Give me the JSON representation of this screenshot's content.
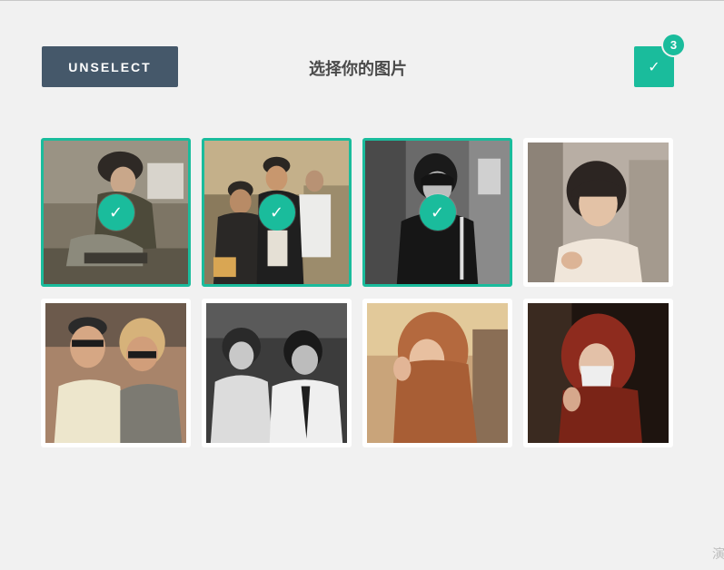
{
  "toolbar": {
    "unselect_label": "UNSELECT",
    "title": "选择你的图片",
    "confirm_icon": "check-icon",
    "selected_count": "3",
    "accent_color": "#1abc9c",
    "button_color": "#45586a"
  },
  "gallery": {
    "photos": [
      {
        "description": "woman in fur hat crouching on street",
        "selected": true,
        "check": "✓"
      },
      {
        "description": "two men in hats on street",
        "selected": true,
        "check": "✓"
      },
      {
        "description": "black and white woman with bangs",
        "selected": true,
        "check": "✓"
      },
      {
        "description": "woman with bob haircut",
        "selected": false
      },
      {
        "description": "couple with glasses and sunglasses",
        "selected": false
      },
      {
        "description": "black and white two women",
        "selected": false
      },
      {
        "description": "woman with long auburn hair",
        "selected": false
      },
      {
        "description": "woman with red hair and face mask",
        "selected": false
      }
    ]
  },
  "watermark": "演"
}
